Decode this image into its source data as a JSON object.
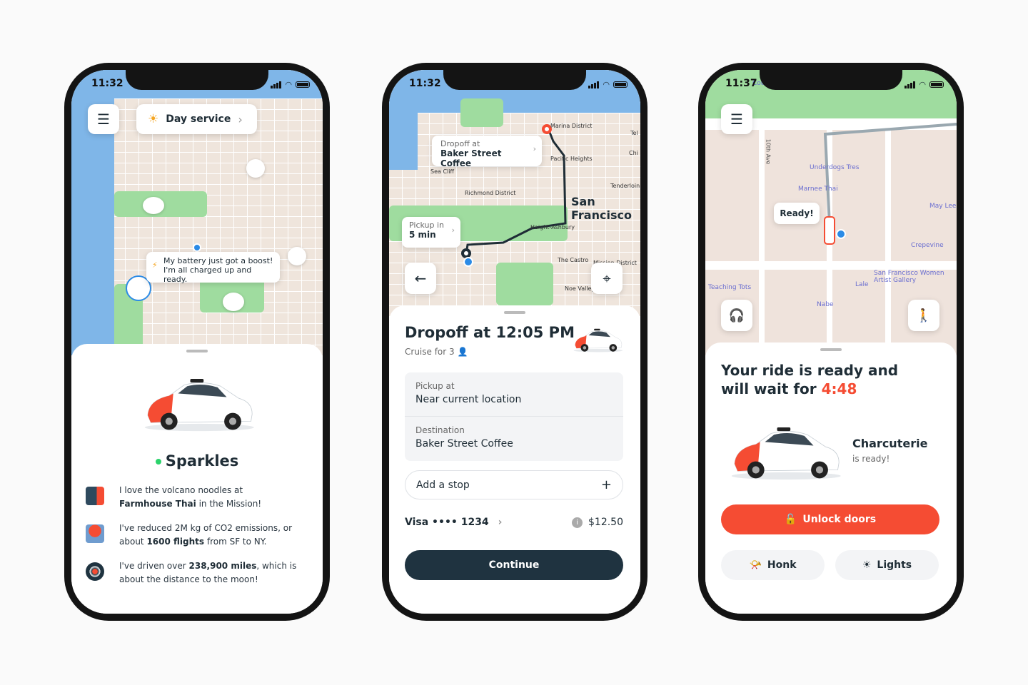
{
  "status_icons": [
    "signal-icon",
    "wifi-icon",
    "battery-icon"
  ],
  "colors": {
    "accent_red": "#f54c33",
    "dark": "#1f3340",
    "green_dot": "#2bd36b",
    "user_blue": "#2b8be6"
  },
  "phone1": {
    "time": "11:32",
    "service_label": "Day service",
    "bubble": {
      "line1": "My battery just got a boost!",
      "line2": "I'm all charged up and ready."
    },
    "car_name": "Sparkles",
    "facts": [
      {
        "pre": "I love the volcano noodles at ",
        "bold": "Farmhouse Thai",
        "post": " in the Mission!",
        "icon": "city-icon"
      },
      {
        "pre": "I've reduced 2M kg of CO2 emissions, or about ",
        "bold": "1600 flights",
        "post": " from SF to NY.",
        "icon": "flower-icon"
      },
      {
        "pre": "I've driven over ",
        "bold": "238,900 miles",
        "post": ", which is about the distance to the moon!",
        "icon": "moon-radar-icon"
      }
    ]
  },
  "phone2": {
    "time": "11:32",
    "dropoff_bubble": {
      "label": "Dropoff at",
      "value": "Baker Street Coffee"
    },
    "pickup_bubble": {
      "label": "Pickup in",
      "value": "5 min"
    },
    "map_labels": [
      "Marina District",
      "Pacific Heights",
      "Sea Cliff",
      "Richmond District",
      "San Francisco",
      "Tenderloin",
      "Haight-Ashbury",
      "The Castro",
      "Mission District",
      "Noe Valley",
      "Tel",
      "Chi"
    ],
    "title": "Dropoff at 12:05 PM",
    "subtitle": "Cruise for 3",
    "pickup": {
      "label": "Pickup at",
      "value": "Near current location"
    },
    "destination": {
      "label": "Destination",
      "value": "Baker Street Coffee"
    },
    "add_stop": "Add a stop",
    "payment": "Visa •••• 1234",
    "price": "$12.50",
    "continue": "Continue"
  },
  "phone3": {
    "time": "11:37",
    "ready_bubble": "Ready!",
    "street": "10th Ave",
    "pois": [
      "Underdogs Tres",
      "Marnee Thai",
      "May Lee",
      "Crepevine",
      "San Francisco Women Artist Gallery",
      "Lale",
      "Nabe",
      "Teaching Tots",
      "County Fair Building"
    ],
    "title_pre": "Your ride is ready and will wait for ",
    "countdown": "4:48",
    "car_name": "Charcuterie",
    "car_status": "is ready!",
    "unlock": "Unlock doors",
    "honk": "Honk",
    "lights": "Lights"
  }
}
